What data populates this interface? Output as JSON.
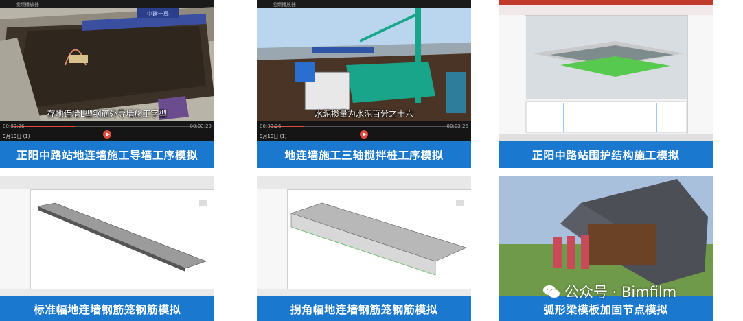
{
  "cards": [
    {
      "caption": "正阳中路站地连墙施工导墙工序模拟",
      "subtitle": "存地连墙L型钢筋外导墙施工字型",
      "player_title": "视频播放器",
      "time_left": "00:03:26",
      "time_right": "00:03:29",
      "bottom_label": "9月19日 (1)",
      "progress": 0.33
    },
    {
      "caption": "地连墙施工三轴搅拌桩工序模拟",
      "subtitle": "水泥掺量为水泥百分之十六",
      "player_title": "视频播放器",
      "time_left": "00:03:26",
      "time_right": "00:03:26",
      "bottom_label": "9月19日 (1)",
      "progress": 0.18
    },
    {
      "caption": "正阳中路站围护结构施工模拟"
    },
    {
      "caption": "标准幅地连墙钢筋笼钢筋模拟"
    },
    {
      "caption": "拐角幅地连墙钢筋笼钢筋模拟"
    },
    {
      "caption": "弧形梁模板加固节点模拟"
    }
  ],
  "watermark": {
    "text": "公众号 · Bimfilm",
    "icon": "wechat-icon"
  },
  "colors": {
    "caption_bg": "#1b78cf",
    "caption_text": "#ffffff",
    "progress": "#e24a3b"
  }
}
